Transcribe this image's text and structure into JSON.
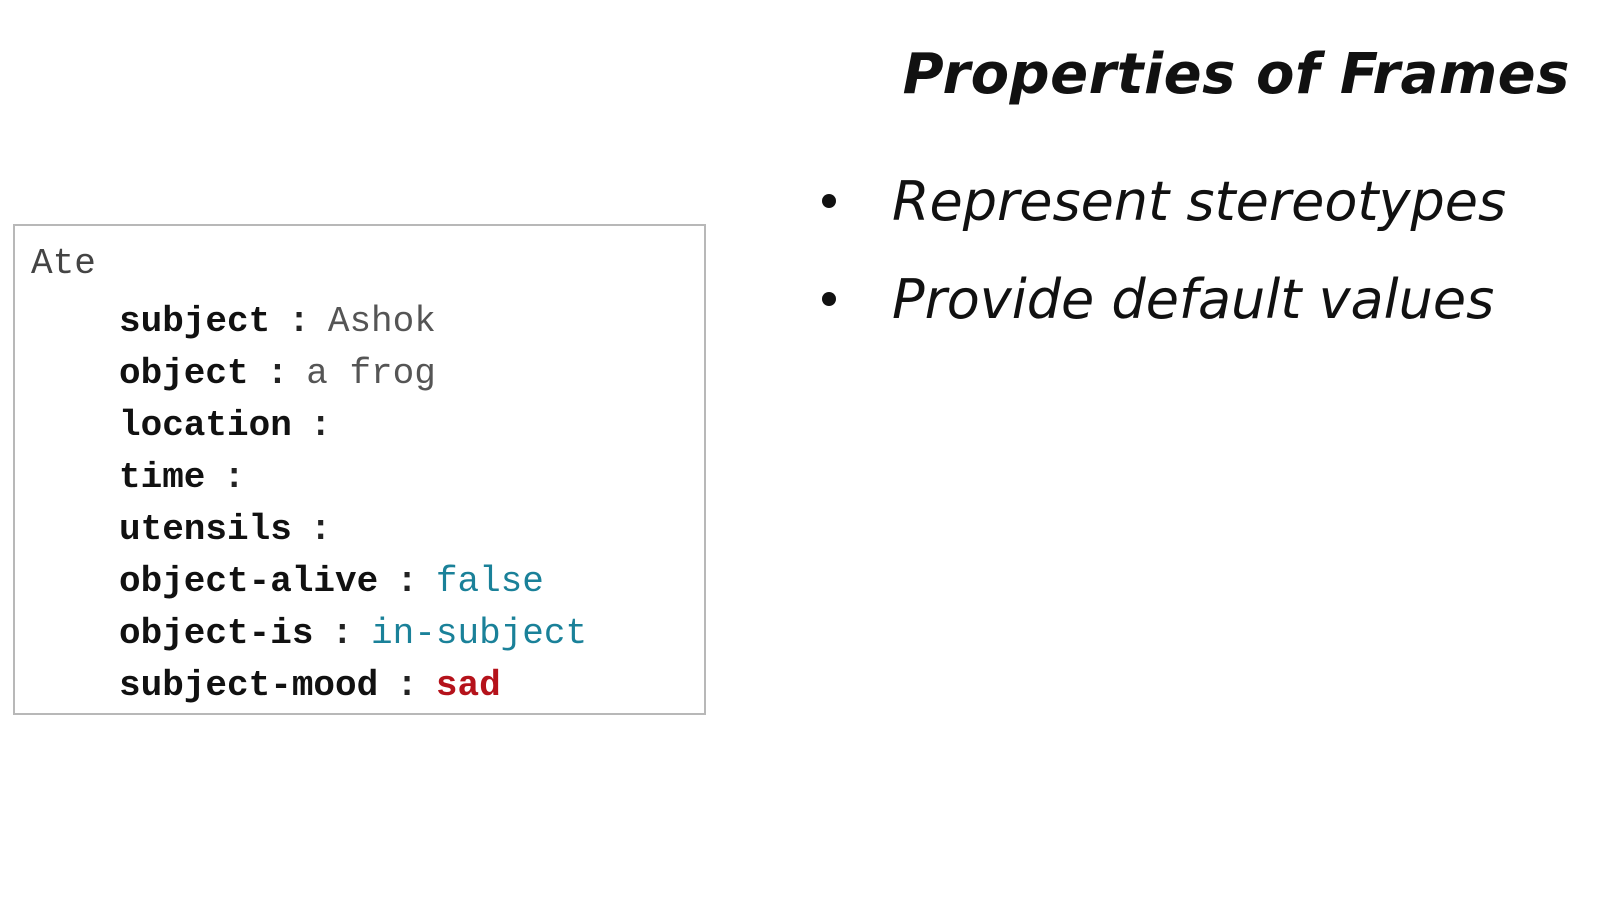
{
  "slide": {
    "title": "Properties of Frames",
    "bullets": [
      "Represent stereotypes",
      "Provide default values"
    ]
  },
  "frame": {
    "name": "Ate",
    "separator": ":",
    "slots": [
      {
        "key": "subject",
        "value": "Ashok",
        "style": "plain"
      },
      {
        "key": "object",
        "value": "a frog",
        "style": "plain"
      },
      {
        "key": "location",
        "value": "",
        "style": "plain"
      },
      {
        "key": "time",
        "value": "",
        "style": "plain"
      },
      {
        "key": "utensils",
        "value": "",
        "style": "plain"
      },
      {
        "key": "object-alive",
        "value": "false",
        "style": "teal"
      },
      {
        "key": "object-is",
        "value": "in-subject",
        "style": "teal"
      },
      {
        "key": "subject-mood",
        "value": "sad",
        "style": "red"
      }
    ]
  },
  "colors": {
    "text": "#111111",
    "default_value_teal": "#1a8199",
    "default_value_red": "#b5121b",
    "box_border": "#b8b8b8"
  }
}
